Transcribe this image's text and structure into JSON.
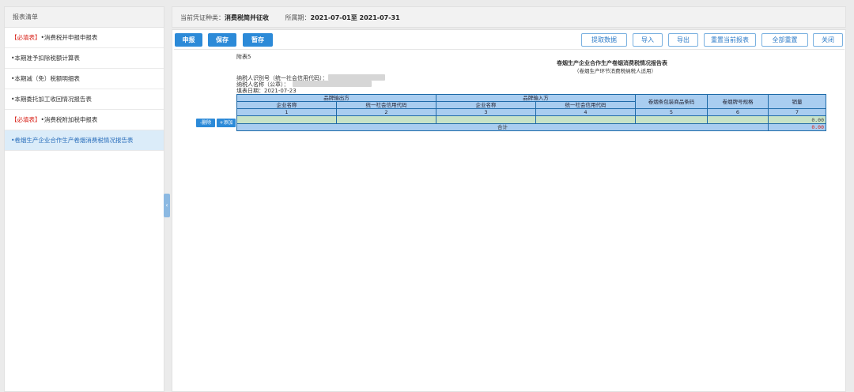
{
  "sidebar": {
    "header": "报表清单",
    "items": [
      {
        "tag": "【必填表】",
        "label": "•消费税并申报申报表"
      },
      {
        "tag": "",
        "label": "•本期准予扣除税额计算表"
      },
      {
        "tag": "",
        "label": "•本期减（免）税额明细表"
      },
      {
        "tag": "",
        "label": "•本期委托加工收回情况报告表"
      },
      {
        "tag": "【必填表】",
        "label": "•消费税附加税申报表"
      },
      {
        "tag": "",
        "label": "•卷烟生产企业合作生产卷烟消费税情况报告表"
      }
    ]
  },
  "infobar": {
    "voucher_label": "当前凭证种类：",
    "voucher_value": "消费税简并征收",
    "period_label": "所属期：",
    "period_value": "2021-07-01至 2021-07-31"
  },
  "toolbar": {
    "submit": "申报",
    "save": "保存",
    "draft": "暂存",
    "fetch": "提取数据",
    "import": "导入",
    "export": "导出",
    "reset_current": "重置当前报表",
    "reset_all": "全部重置",
    "close": "关闭"
  },
  "report": {
    "attachment": "附表5",
    "title": "卷烟生产企业合作生产卷烟消费税情况报告表",
    "subtitle": "（卷烟生产环节消费税纳税人适用）",
    "taxpayer_id_label": "纳税人识别号（统一社会信用代码）：",
    "taxpayer_name_label": "纳税人名称（公章）：",
    "fill_date_label": "填表日期：2021-07-23",
    "group_out": "品牌输出方",
    "group_in": "品牌输入方",
    "col_company_name": "企业名称",
    "col_credit_code": "统一社会信用代码",
    "col_barcode": "卷烟条包装商品条码",
    "col_spec": "卷烟牌号规格",
    "col_sales": "销量",
    "col_nums": [
      "1",
      "2",
      "3",
      "4",
      "5",
      "6",
      "7"
    ],
    "row_sales": "0.00",
    "total_label": "合计",
    "total_value": "0.00",
    "btn_delete": "-删除",
    "btn_add": "+添加"
  }
}
